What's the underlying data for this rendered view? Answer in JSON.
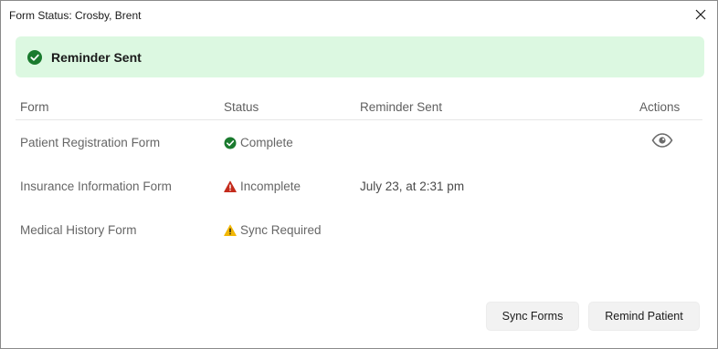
{
  "window": {
    "title": "Form Status: Crosby, Brent"
  },
  "banner": {
    "message": "Reminder Sent",
    "icon": "check-circle-icon",
    "background": "#dcf8e1",
    "icon_color": "#1a7a2e"
  },
  "table": {
    "headers": {
      "form": "Form",
      "status": "Status",
      "reminder": "Reminder Sent",
      "actions": "Actions"
    },
    "rows": [
      {
        "form": "Patient Registration Form",
        "status": "Complete",
        "status_icon": "check-circle-icon",
        "reminder": "",
        "action_icon": "eye-icon"
      },
      {
        "form": "Insurance Information Form",
        "status": "Incomplete",
        "status_icon": "warning-red-icon",
        "reminder": "July 23, at 2:31 pm"
      },
      {
        "form": "Medical History Form",
        "status": "Sync Required",
        "status_icon": "warning-yellow-icon",
        "reminder": ""
      }
    ]
  },
  "colors": {
    "complete": "#1a7a2e",
    "incomplete": "#c42b1c",
    "sync_required": "#f2b705"
  },
  "buttons": {
    "sync": "Sync Forms",
    "remind": "Remind Patient"
  }
}
